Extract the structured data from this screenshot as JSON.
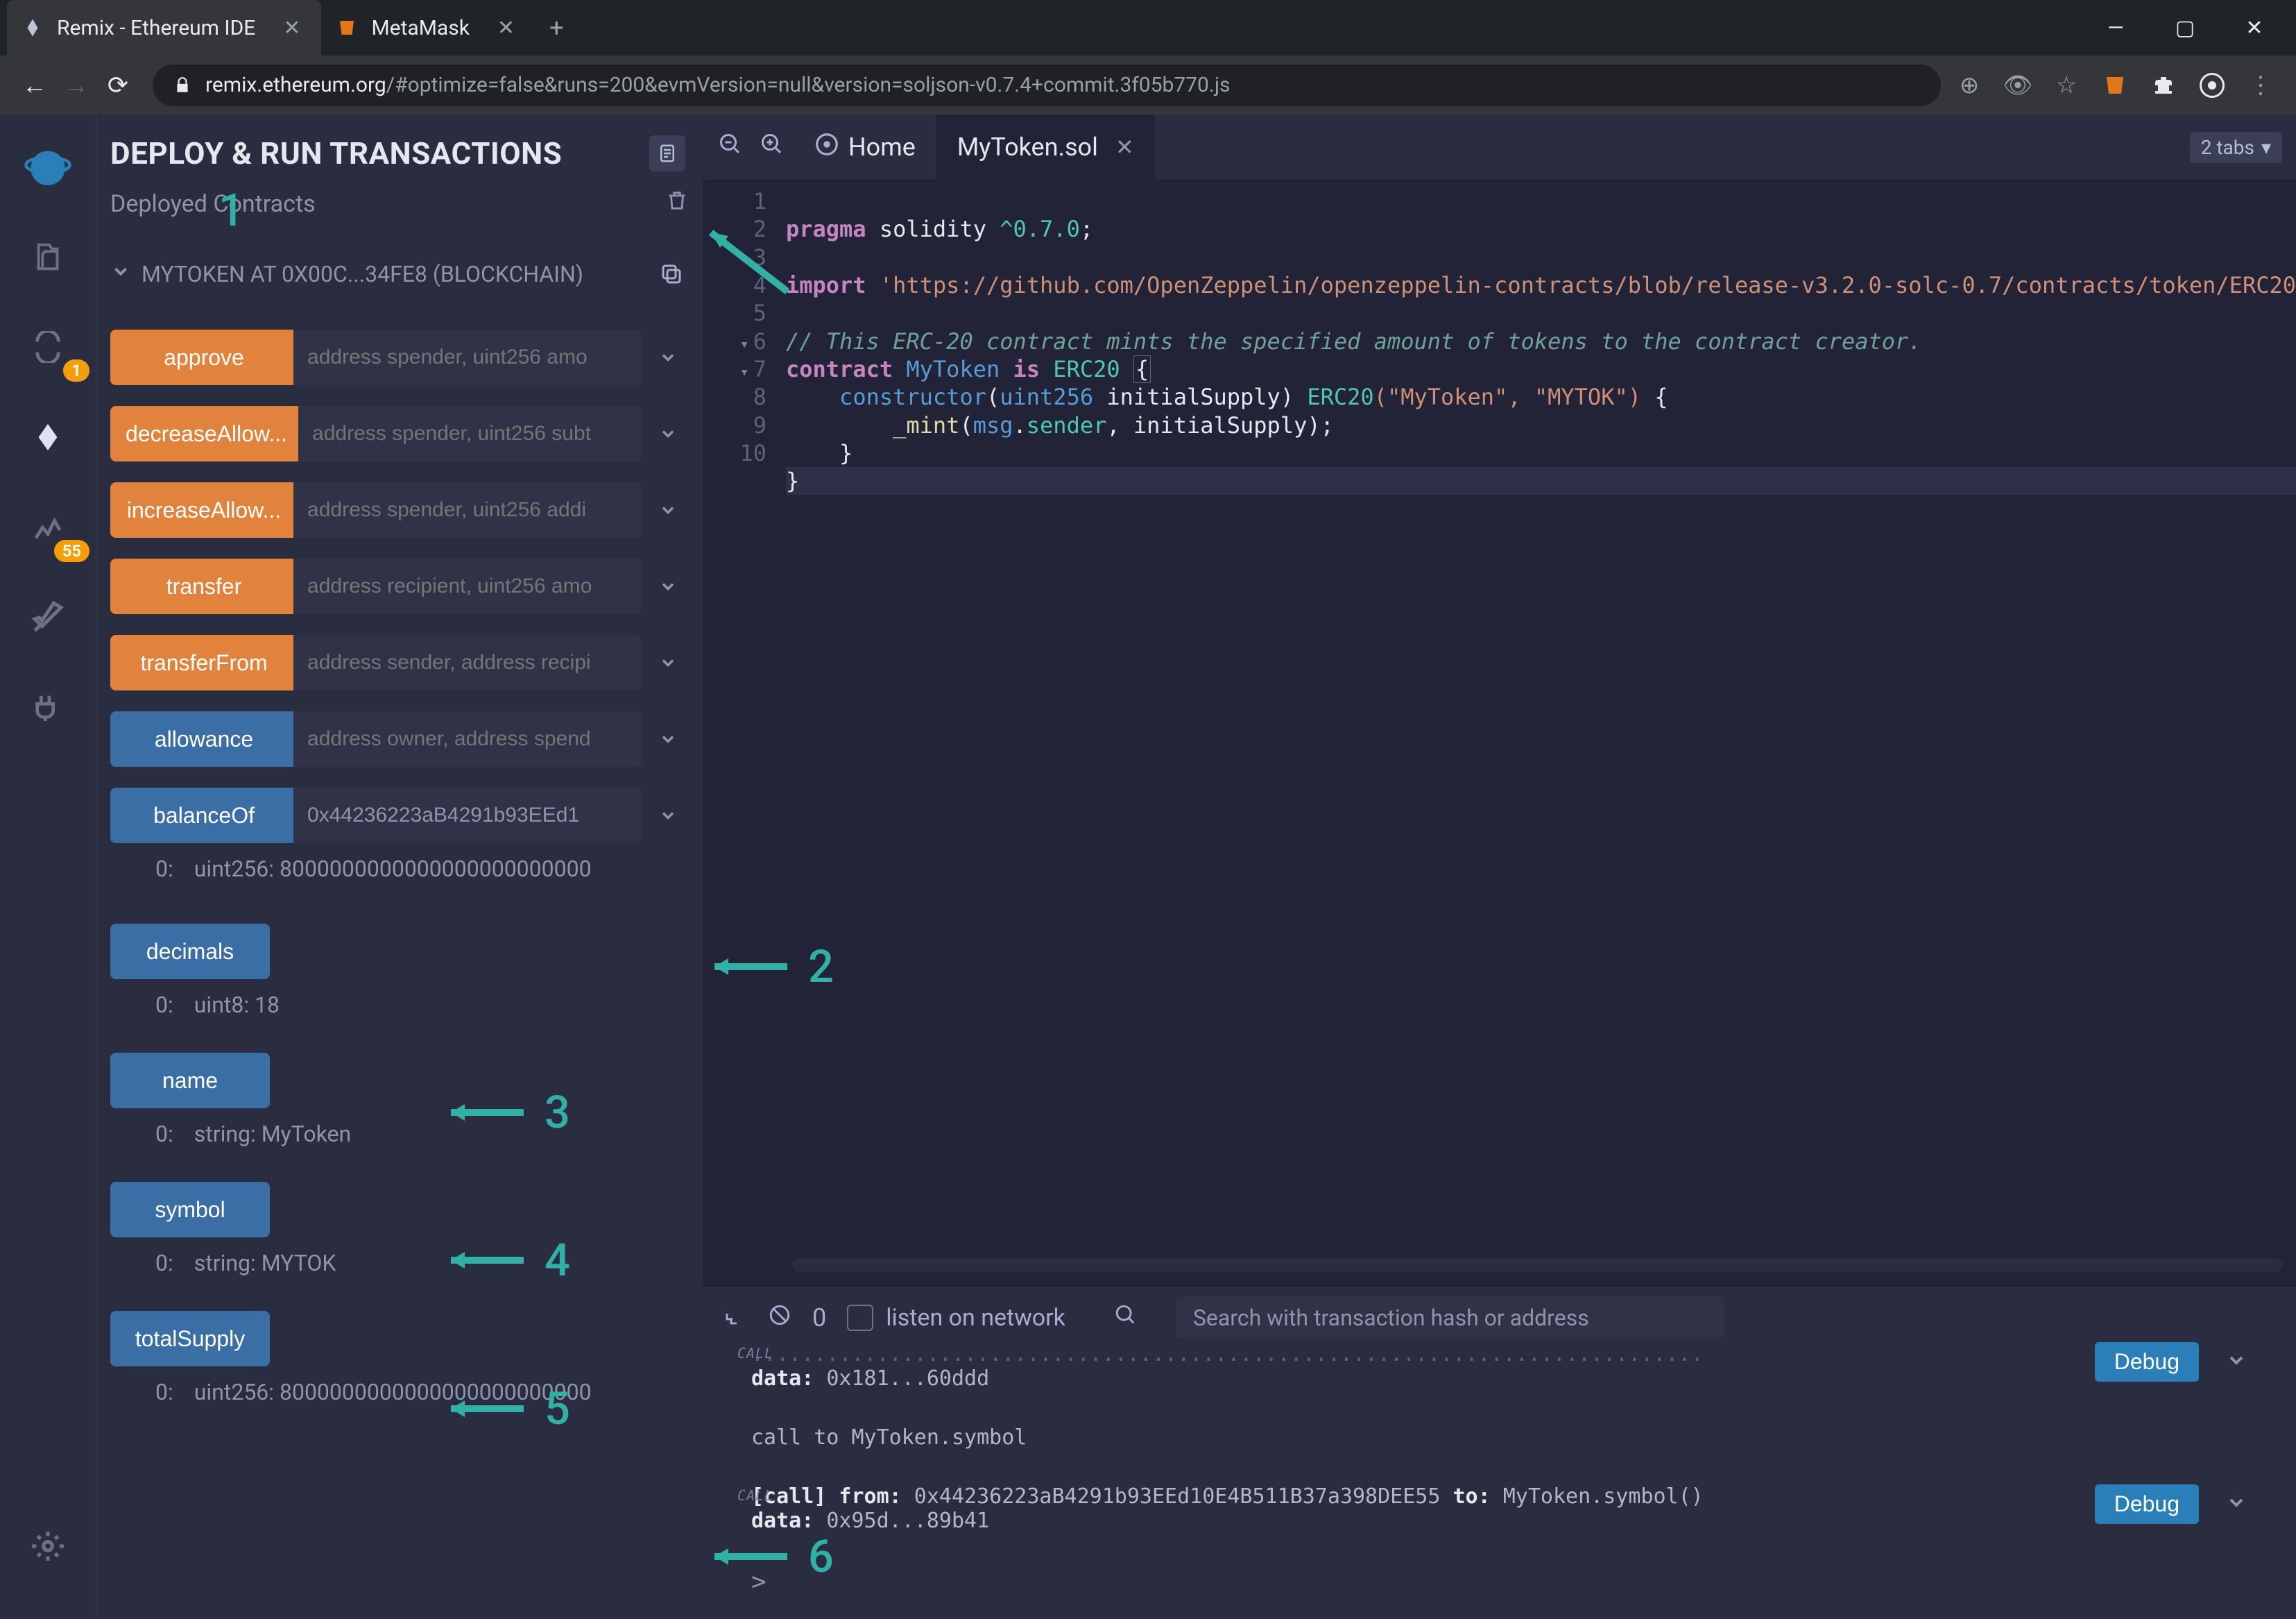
{
  "browser": {
    "tabs": [
      {
        "title": "Remix - Ethereum IDE",
        "active": true
      },
      {
        "title": "MetaMask",
        "active": false
      }
    ],
    "url_domain": "remix.ethereum.org",
    "url_path": "/#optimize=false&runs=200&evmVersion=null&version=soljson-v0.7.4+commit.3f05b770.js"
  },
  "iconbar_badges": {
    "solidity": "1",
    "analysis": "55"
  },
  "panel": {
    "title": "DEPLOY & RUN TRANSACTIONS",
    "deployed_label": "Deployed Contracts",
    "contract_name": "MYTOKEN AT 0X00C...34FE8 (BLOCKCHAIN)",
    "fns": {
      "approve": {
        "label": "approve",
        "ph": "address spender, uint256 amo",
        "color": "orange"
      },
      "decrease": {
        "label": "decreaseAllow...",
        "ph": "address spender, uint256 subt",
        "color": "orange"
      },
      "increase": {
        "label": "increaseAllow...",
        "ph": "address spender, uint256 addi",
        "color": "orange"
      },
      "transfer": {
        "label": "transfer",
        "ph": "address recipient, uint256 amo",
        "color": "orange"
      },
      "transferFrom": {
        "label": "transferFrom",
        "ph": "address sender, address recipi",
        "color": "orange"
      },
      "allowance": {
        "label": "allowance",
        "ph": "address owner, address spend",
        "color": "blue"
      },
      "balanceOf": {
        "label": "balanceOf",
        "val": "0x44236223aB4291b93EEd1",
        "color": "blue",
        "result_idx": "0:",
        "result_val": "uint256: 8000000000000000000000000"
      },
      "decimals": {
        "label": "decimals",
        "color": "blue",
        "result_idx": "0:",
        "result_val": "uint8: 18"
      },
      "name": {
        "label": "name",
        "color": "blue",
        "result_idx": "0:",
        "result_val": "string: MyToken"
      },
      "symbol": {
        "label": "symbol",
        "color": "blue",
        "result_idx": "0:",
        "result_val": "string: MYTOK"
      },
      "totalSupply": {
        "label": "totalSupply",
        "color": "blue",
        "result_idx": "0:",
        "result_val": "uint256: 8000000000000000000000000"
      }
    }
  },
  "editor": {
    "home_label": "Home",
    "file_tab": "MyToken.sol",
    "tabs_btn": "2 tabs",
    "gutter": [
      "1",
      "2",
      "3",
      "4",
      "5",
      "6",
      "7",
      "8",
      "9",
      "10"
    ],
    "code": {
      "l1_kw": "pragma",
      "l1_id": " solidity ",
      "l1_ver": "^0.7.0",
      "l1_sc": ";",
      "l3_kw": "import",
      "l3_str": " 'https://github.com/OpenZeppelin/openzeppelin-contracts/blob/release-v3.2.0-solc-0.7/contracts/token/ERC20",
      "l3_sc": "",
      "l5_co": "// This ERC-20 contract mints the specified amount of tokens to the contract creator.",
      "l6_kw1": "contract",
      "l6_name": " MyToken ",
      "l6_kw2": "is",
      "l6_base": " ERC20 ",
      "l6_brace": "{",
      "l7_kw": "    constructor",
      "l7_p1": "(",
      "l7_ty": "uint256",
      "l7_arg": " initialSupply",
      "l7_p2": ") ",
      "l7_erc": "ERC20",
      "l7_args": "(\"MyToken\", \"MYTOK\")",
      "l7_brace": " {",
      "l8_pre": "        ",
      "l8_fn": "_mint",
      "l8_p1": "(",
      "l8_msg": "msg",
      "l8_dot": ".",
      "l8_sender": "sender",
      "l8_rest": ", initialSupply);",
      "l9": "    }",
      "l10": "}"
    }
  },
  "terminal": {
    "zero": "0",
    "listen_label": "listen on network",
    "search_ph": "Search with transaction hash or address",
    "entries": [
      {
        "data_label": "data:",
        "data_val": " 0x181...60ddd",
        "debug": "Debug"
      },
      {
        "line1": "call to MyToken.symbol"
      },
      {
        "call_label": "[call]",
        "from_label": "  from:",
        "from_val": " 0x44236223aB4291b93EEd10E4B511B37a398DEE55 ",
        "to_label": "to:",
        "to_val": " MyToken.symbol()",
        "data_label": "data:",
        "data_val": " 0x95d...89b41",
        "debug": "Debug"
      }
    ]
  },
  "annotations": {
    "a1": "1",
    "a2": "2",
    "a3": "3",
    "a4": "4",
    "a5": "5",
    "a6": "6"
  }
}
